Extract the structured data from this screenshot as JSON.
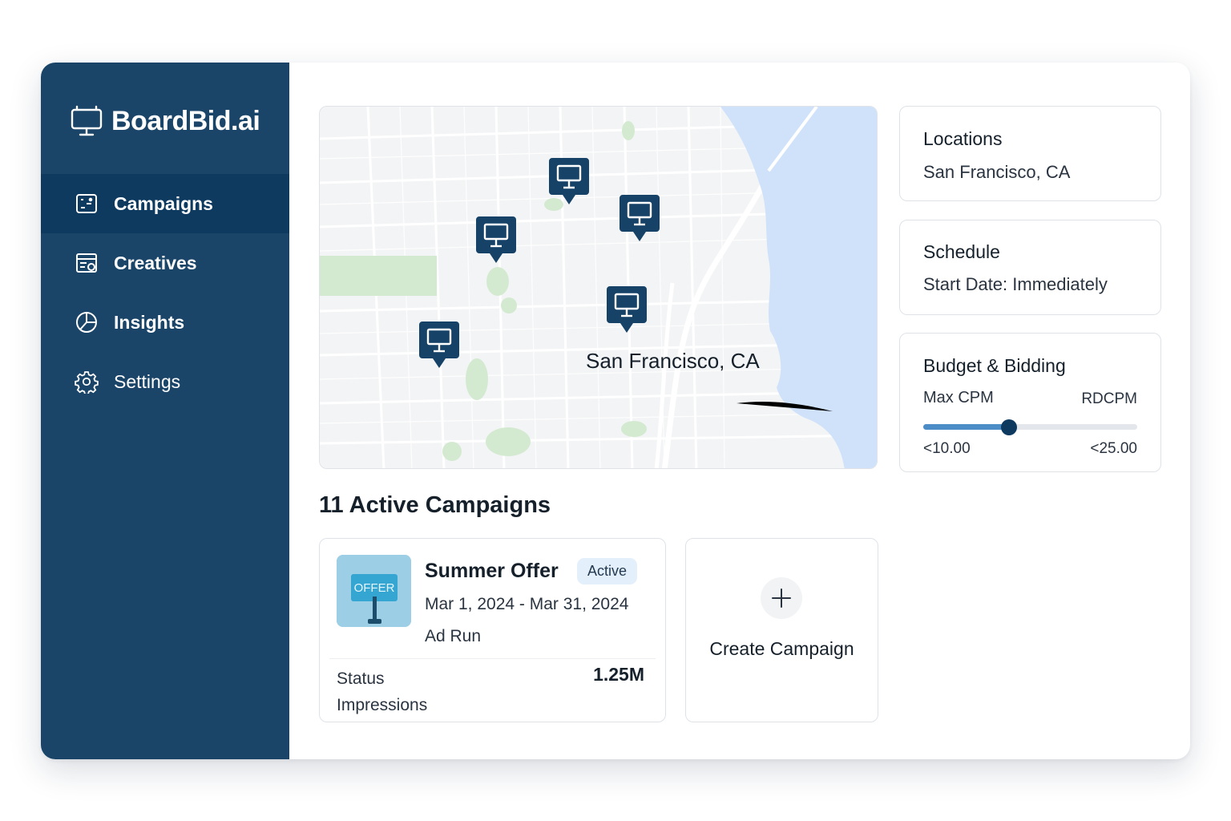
{
  "brand": {
    "name": "BoardBid.ai",
    "logo_icon": "monitor-icon"
  },
  "sidebar": {
    "items": [
      {
        "label": "Campaigns",
        "icon": "campaigns-icon",
        "active": true
      },
      {
        "label": "Creatives",
        "icon": "creatives-icon",
        "active": false
      },
      {
        "label": "Insights",
        "icon": "pie-chart-icon",
        "active": false
      },
      {
        "label": "Settings",
        "icon": "gear-icon",
        "active": false
      }
    ]
  },
  "map": {
    "location_label": "San Francisco, CA",
    "pin_icon": "billboard-pin-icon",
    "colors": {
      "water": "#cfe2fa",
      "park": "#d3ead1",
      "pin": "#174268"
    }
  },
  "campaigns": {
    "heading": "11 Active Campaigns",
    "items": [
      {
        "name": "Summer Offer",
        "status": "Active",
        "dates": "Mar 1, 2024 - Mar 31, 2024",
        "run": "Ad Run",
        "thumb_text": "OFFER",
        "stat_label_1": "Status",
        "stat_label_2": "Impressions",
        "stat_value": "1.25M"
      }
    ],
    "create_label": "Create Campaign"
  },
  "panels": {
    "locations": {
      "title": "Locations",
      "value": "San Francisco, CA"
    },
    "schedule": {
      "title": "Schedule",
      "value": "Start Date: Immediately"
    },
    "budget": {
      "title": "Budget & Bidding",
      "left_label": "Max CPM",
      "right_label": "RDCPM",
      "min_label": "<10.00",
      "max_label": "<25.00",
      "slider_fraction": 0.4
    }
  },
  "colors": {
    "sidebar": "#1a4569",
    "sidebar_active": "#0f3a60",
    "accent": "#4c8cc7"
  }
}
